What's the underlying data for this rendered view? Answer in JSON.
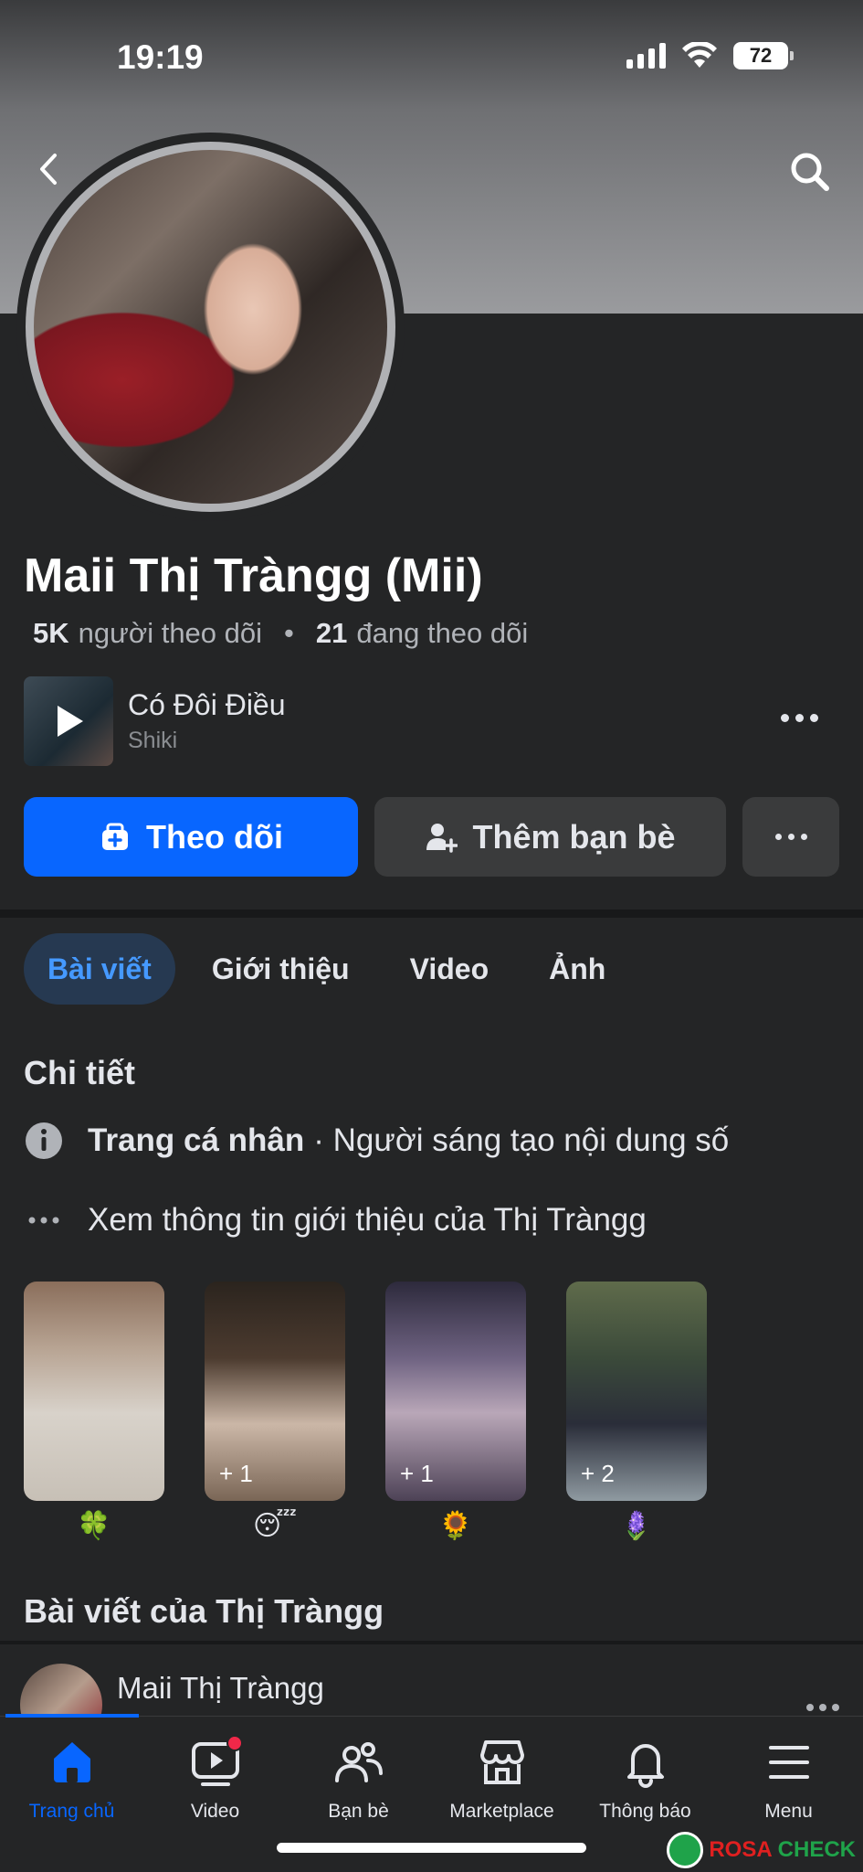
{
  "status": {
    "time": "19:19",
    "battery": "72"
  },
  "profile": {
    "name": "Maii Thị Tràngg (Mii)",
    "followers_count": "5K",
    "followers_label": "người theo dõi",
    "following_count": "21",
    "following_label": "đang theo dõi"
  },
  "music": {
    "title": "Có Đôi Điều",
    "artist": "Shiki"
  },
  "actions": {
    "follow": "Theo dõi",
    "add_friend": "Thêm bạn bè"
  },
  "tabs": [
    "Bài viết",
    "Giới thiệu",
    "Video",
    "Ảnh"
  ],
  "details": {
    "title": "Chi tiết",
    "profile_type_bold": "Trang cá nhân",
    "profile_type_rest": "· Người sáng tạo nội dung số",
    "see_about": "Xem thông tin giới thiệu của Thị Tràngg"
  },
  "highlights": [
    {
      "count": "",
      "emoji": "🍀"
    },
    {
      "count": "+ 1",
      "emoji": "😴"
    },
    {
      "count": "+ 1",
      "emoji": "🌻"
    },
    {
      "count": "+ 2",
      "emoji": "🪻"
    }
  ],
  "posts": {
    "title": "Bài viết của Thị Tràngg",
    "author": "Maii Thị Tràngg"
  },
  "nav": [
    "Trang chủ",
    "Video",
    "Bạn bè",
    "Marketplace",
    "Thông báo",
    "Menu"
  ],
  "watermark": {
    "left": "ROSA",
    "right": "CHECK"
  },
  "colors": {
    "accent": "#0866ff",
    "background": "#242526",
    "button_secondary": "#3a3b3c"
  }
}
